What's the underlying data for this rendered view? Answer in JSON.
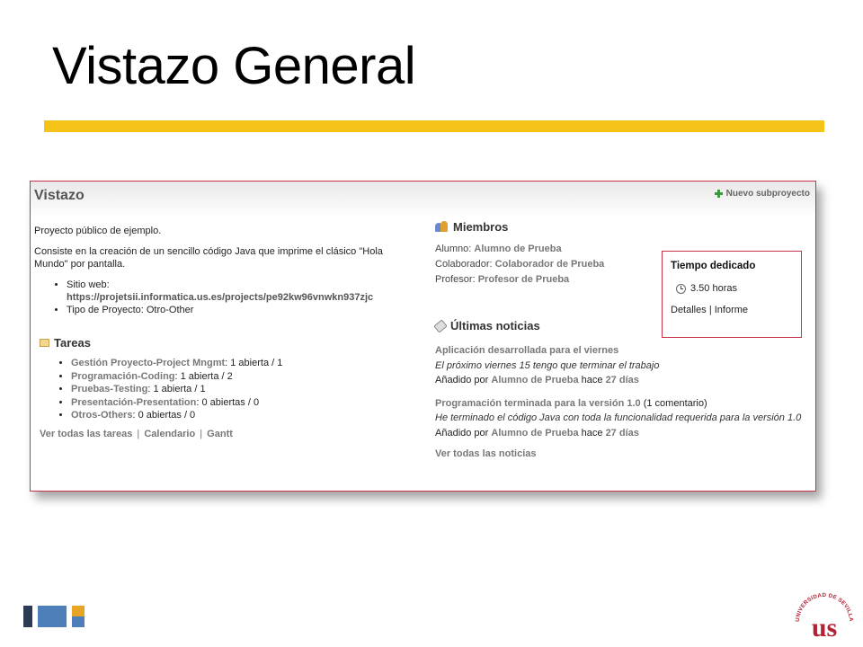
{
  "slide": {
    "title": "Vistazo General"
  },
  "page": {
    "heading": "Vistazo",
    "new_subproject": "Nuevo subproyecto"
  },
  "description": {
    "intro": "Proyecto público de ejemplo.",
    "detail": "Consiste en la creación de un sencillo código Java que imprime el clásico \"Hola Mundo\" por pantalla.",
    "website_label": "Sitio web:",
    "website_url": "https://projetsii.informatica.us.es/projects/pe92kw96vnwkn937zjc",
    "type_label": "Tipo de Proyecto:",
    "type_value": "Otro-Other"
  },
  "tasks": {
    "heading": "Tareas",
    "items": [
      {
        "name": "Gestión Proyecto-Project Mngmt",
        "counts": ": 1 abierta / 1"
      },
      {
        "name": "Programación-Coding",
        "counts": ": 1 abierta / 2"
      },
      {
        "name": "Pruebas-Testing",
        "counts": ": 1 abierta / 1"
      },
      {
        "name": "Presentación-Presentation",
        "counts": ": 0 abiertas / 0"
      },
      {
        "name": "Otros-Others",
        "counts": ": 0 abiertas / 0"
      }
    ],
    "links": {
      "all": "Ver todas las tareas",
      "calendar": "Calendario",
      "gantt": "Gantt",
      "separator": "|"
    }
  },
  "members": {
    "heading": "Miembros",
    "rows": [
      {
        "role": "Alumno:",
        "name": "Alumno de Prueba"
      },
      {
        "role": "Colaborador:",
        "name": "Colaborador de Prueba"
      },
      {
        "role": "Profesor:",
        "name": "Profesor de Prueba"
      }
    ]
  },
  "time": {
    "title": "Tiempo dedicado",
    "hours": "3.50 horas",
    "details": "Detalles",
    "separator": "|",
    "report": "Informe"
  },
  "news": {
    "heading": "Últimas noticias",
    "items": [
      {
        "title": "Aplicación desarrollada para el viernes",
        "comments": "",
        "desc": "El próximo viernes 15 tengo que terminar el trabajo",
        "added_by": "Añadido por",
        "author": "Alumno de Prueba",
        "ago_prefix": "hace",
        "ago": "27 días"
      },
      {
        "title": "Programación terminada para la versión 1.0",
        "comments": " (1 comentario)",
        "desc": "He terminado el código Java con toda la funcionalidad requerida para la versión 1.0",
        "added_by": "Añadido por",
        "author": "Alumno de Prueba",
        "ago_prefix": "hace",
        "ago": "27 días"
      }
    ],
    "all": "Ver todas las noticias"
  },
  "logo": {
    "text": "UNIVERSIDAD DE SEVILLA"
  },
  "colors": {
    "accent_bar": "#f5c218",
    "frame_border": "#c8334a",
    "link_gray": "#777777",
    "logo_red": "#b22234"
  }
}
